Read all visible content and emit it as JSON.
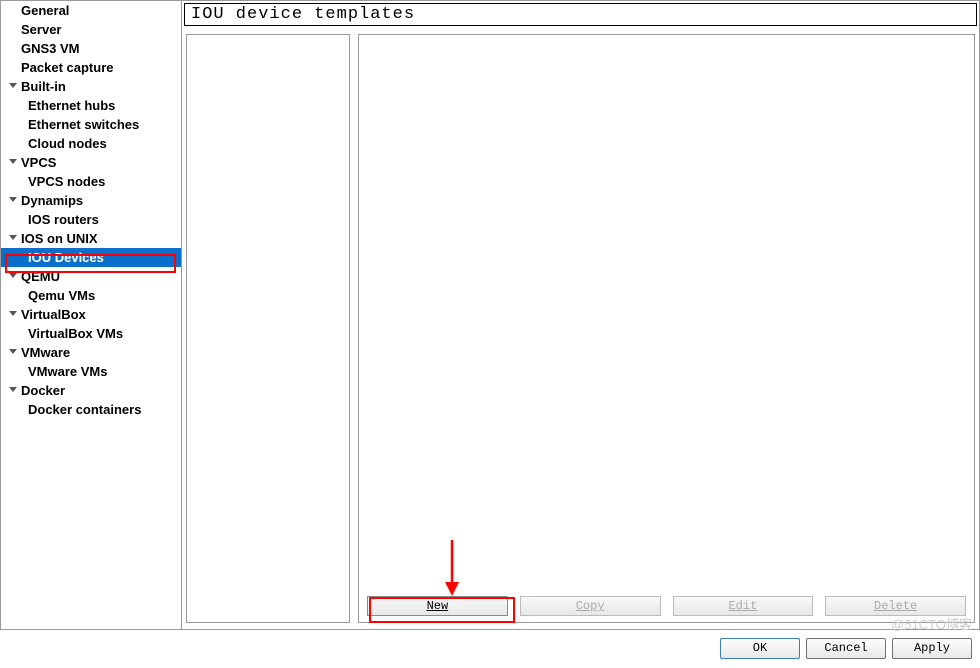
{
  "sidebar": {
    "items": [
      {
        "label": "General",
        "type": "top-level"
      },
      {
        "label": "Server",
        "type": "top-level"
      },
      {
        "label": "GNS3 VM",
        "type": "top-level"
      },
      {
        "label": "Packet capture",
        "type": "top-level"
      },
      {
        "label": "Built-in",
        "type": "expandable"
      },
      {
        "label": "Ethernet hubs",
        "type": "child"
      },
      {
        "label": "Ethernet switches",
        "type": "child"
      },
      {
        "label": "Cloud nodes",
        "type": "child"
      },
      {
        "label": "VPCS",
        "type": "expandable"
      },
      {
        "label": "VPCS nodes",
        "type": "child"
      },
      {
        "label": "Dynamips",
        "type": "expandable"
      },
      {
        "label": "IOS routers",
        "type": "child"
      },
      {
        "label": "IOS on UNIX",
        "type": "expandable"
      },
      {
        "label": "IOU Devices",
        "type": "child",
        "selected": true
      },
      {
        "label": "QEMU",
        "type": "expandable"
      },
      {
        "label": "Qemu VMs",
        "type": "child"
      },
      {
        "label": "VirtualBox",
        "type": "expandable"
      },
      {
        "label": "VirtualBox VMs",
        "type": "child"
      },
      {
        "label": "VMware",
        "type": "expandable"
      },
      {
        "label": "VMware VMs",
        "type": "child"
      },
      {
        "label": "Docker",
        "type": "expandable"
      },
      {
        "label": "Docker containers",
        "type": "child"
      }
    ]
  },
  "content": {
    "header_title": "IOU device templates",
    "panel_buttons": {
      "new": "New",
      "copy": "Copy",
      "edit": "Edit",
      "delete": "Delete"
    }
  },
  "dialog_buttons": {
    "ok": "OK",
    "cancel": "Cancel",
    "apply": "Apply"
  },
  "watermark": "@51CTO博客"
}
